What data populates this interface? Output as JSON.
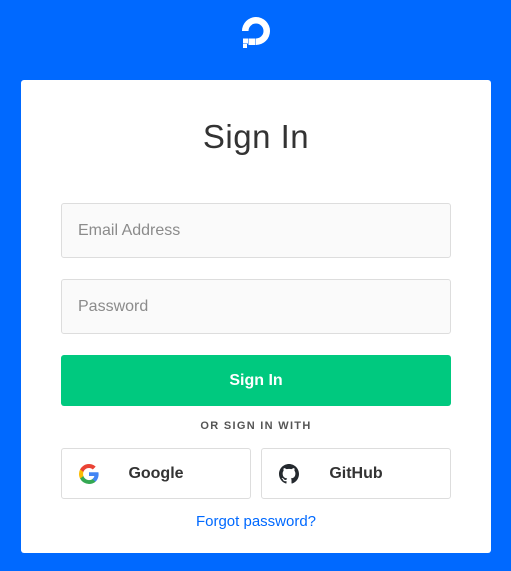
{
  "brand": {
    "logo_icon": "digitalocean-logo-icon",
    "background_color": "#0069ff"
  },
  "form": {
    "title": "Sign In",
    "email_placeholder": "Email Address",
    "password_placeholder": "Password",
    "submit_label": "Sign In",
    "submit_color": "#00c97f",
    "divider_text": "OR SIGN IN WITH",
    "social": [
      {
        "label": "Google",
        "icon": "google-icon"
      },
      {
        "label": "GitHub",
        "icon": "github-icon"
      }
    ],
    "forgot_password": "Forgot password?"
  }
}
